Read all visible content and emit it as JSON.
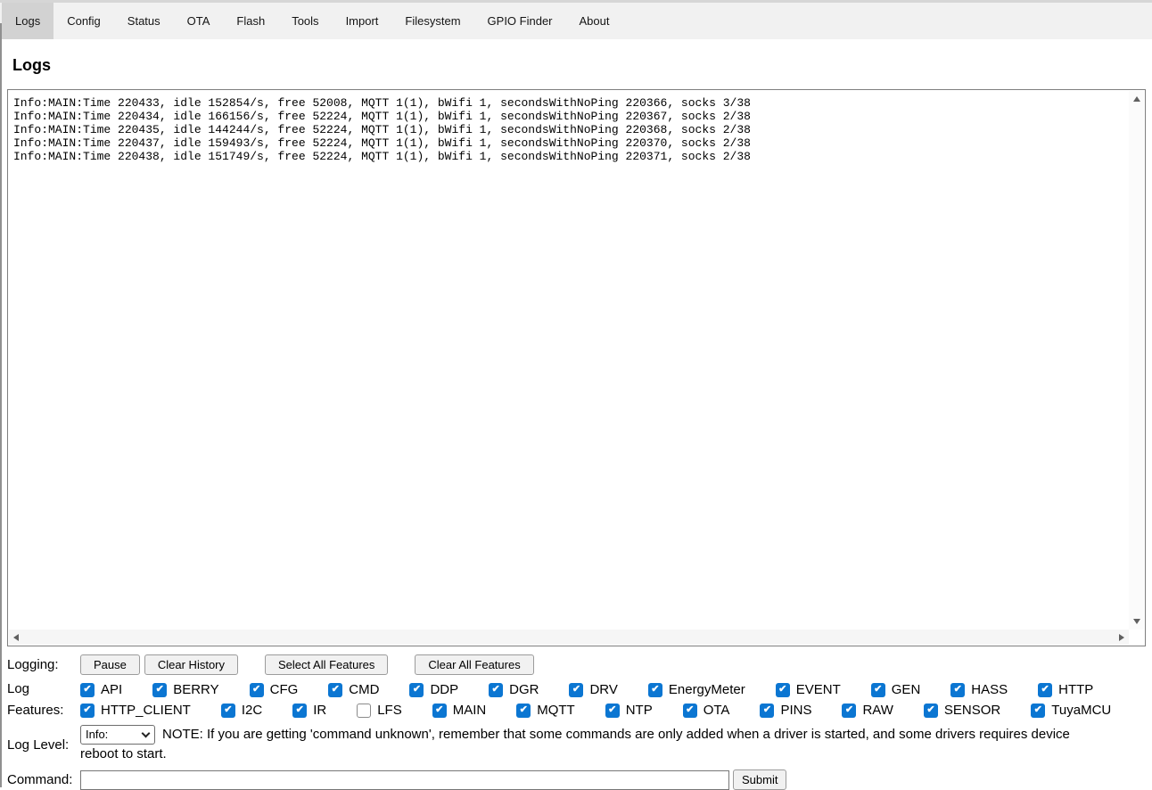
{
  "window": {
    "tab_bar": {
      "tabs": [
        {
          "label": "Logs",
          "active": true
        },
        {
          "label": "Config",
          "active": false
        },
        {
          "label": "Status",
          "active": false
        },
        {
          "label": "OTA",
          "active": false
        },
        {
          "label": "Flash",
          "active": false
        },
        {
          "label": "Tools",
          "active": false
        },
        {
          "label": "Import",
          "active": false
        },
        {
          "label": "Filesystem",
          "active": false
        },
        {
          "label": "GPIO Finder",
          "active": false
        },
        {
          "label": "About",
          "active": false
        }
      ]
    }
  },
  "page": {
    "title": "Logs"
  },
  "log_output": {
    "lines": [
      "Info:MAIN:Time 220433, idle 152854/s, free 52008, MQTT 1(1), bWifi 1, secondsWithNoPing 220366, socks 3/38",
      "Info:MAIN:Time 220434, idle 166156/s, free 52224, MQTT 1(1), bWifi 1, secondsWithNoPing 220367, socks 2/38",
      "Info:MAIN:Time 220435, idle 144244/s, free 52224, MQTT 1(1), bWifi 1, secondsWithNoPing 220368, socks 2/38",
      "Info:MAIN:Time 220437, idle 159493/s, free 52224, MQTT 1(1), bWifi 1, secondsWithNoPing 220370, socks 2/38",
      "Info:MAIN:Time 220438, idle 151749/s, free 52224, MQTT 1(1), bWifi 1, secondsWithNoPing 220371, socks 2/38"
    ]
  },
  "controls": {
    "logging": {
      "label": "Logging:",
      "buttons": [
        {
          "label": "Pause"
        },
        {
          "label": "Clear History"
        },
        {
          "label": "Select All Features"
        },
        {
          "label": "Clear All Features"
        }
      ]
    },
    "features": {
      "label_line1": "Log",
      "label_line2": "Features:",
      "rows": [
        [
          {
            "label": "API",
            "checked": true
          },
          {
            "label": "BERRY",
            "checked": true
          },
          {
            "label": "CFG",
            "checked": true
          },
          {
            "label": "CMD",
            "checked": true
          },
          {
            "label": "DDP",
            "checked": true
          },
          {
            "label": "DGR",
            "checked": true
          },
          {
            "label": "DRV",
            "checked": true
          },
          {
            "label": "EnergyMeter",
            "checked": true
          },
          {
            "label": "EVENT",
            "checked": true
          },
          {
            "label": "GEN",
            "checked": true
          },
          {
            "label": "HASS",
            "checked": true
          },
          {
            "label": "HTTP",
            "checked": true
          }
        ],
        [
          {
            "label": "HTTP_CLIENT",
            "checked": true
          },
          {
            "label": "I2C",
            "checked": true
          },
          {
            "label": "IR",
            "checked": true
          },
          {
            "label": "LFS",
            "checked": false
          },
          {
            "label": "MAIN",
            "checked": true
          },
          {
            "label": "MQTT",
            "checked": true
          },
          {
            "label": "NTP",
            "checked": true
          },
          {
            "label": "OTA",
            "checked": true
          },
          {
            "label": "PINS",
            "checked": true
          },
          {
            "label": "RAW",
            "checked": true
          },
          {
            "label": "SENSOR",
            "checked": true
          },
          {
            "label": "TuyaMCU",
            "checked": true
          }
        ]
      ]
    },
    "log_level": {
      "label": "Log Level:",
      "selected_option": "Info:",
      "note": "NOTE: If you are getting 'command unknown', remember that some commands are only added when a driver is started, and some drivers requires device reboot to start."
    },
    "command": {
      "label": "Command:",
      "value": "",
      "submit_label": "Submit"
    }
  },
  "colors": {
    "checkbox_checked": "#0b76d2",
    "tab_active_bg": "#d2d2d2",
    "tab_bar_bg": "#f1f1f1"
  }
}
